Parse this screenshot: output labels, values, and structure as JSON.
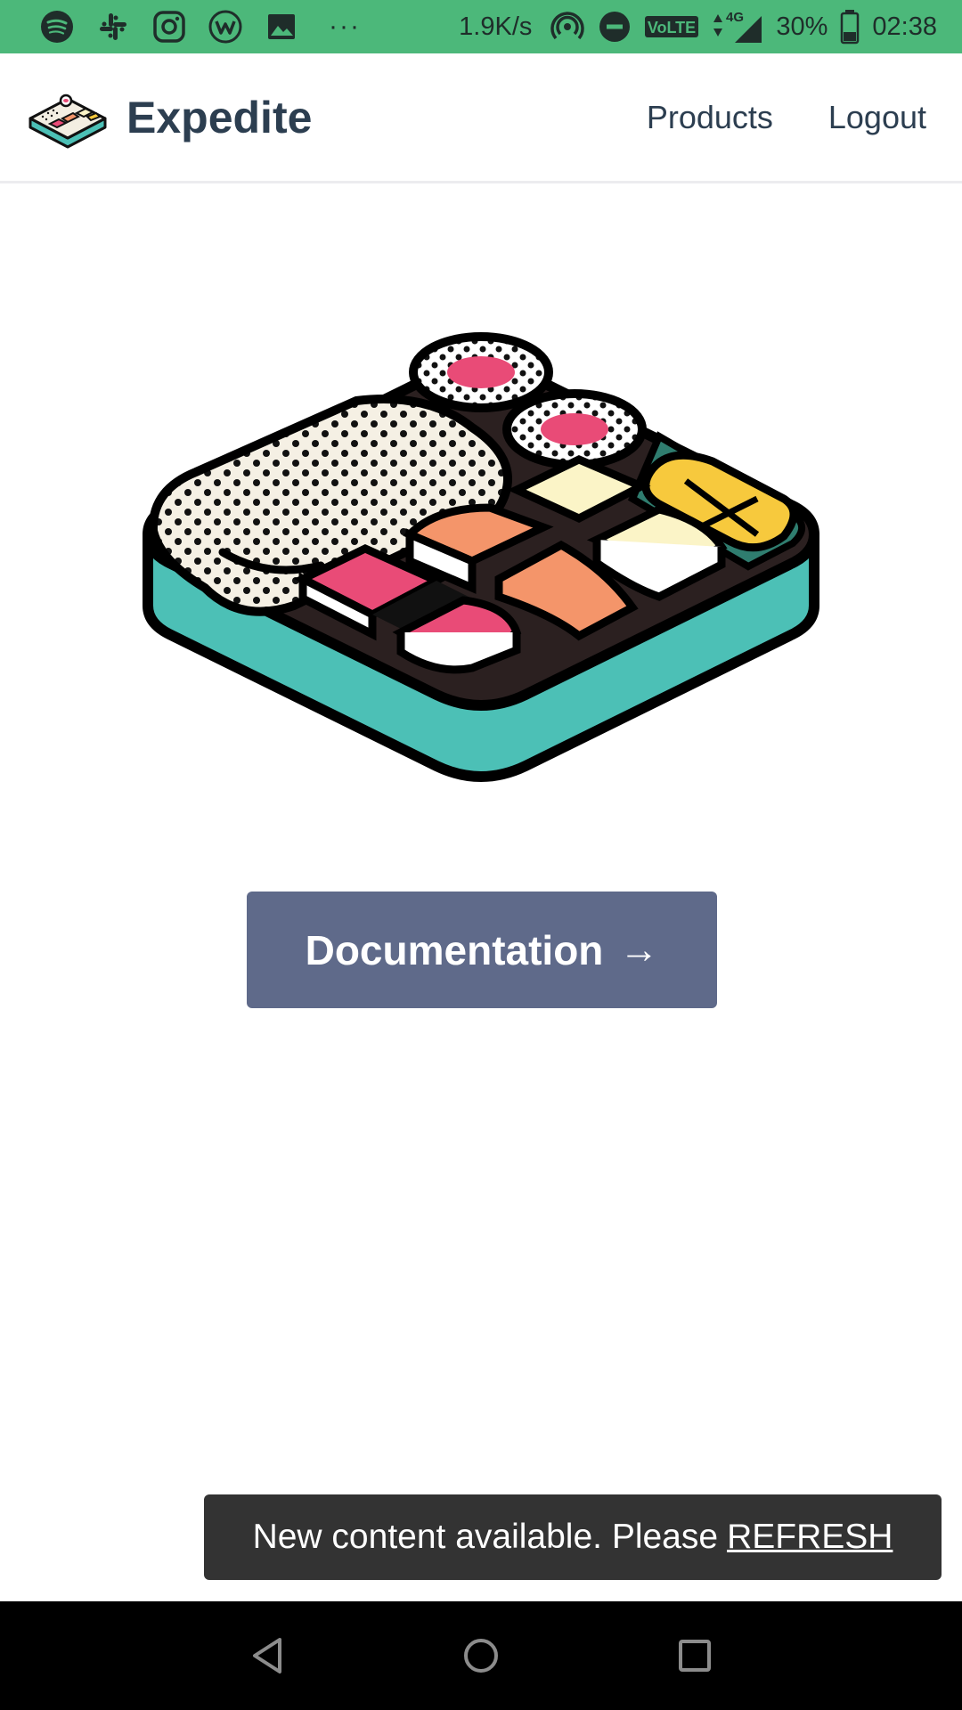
{
  "status_bar": {
    "left_icons": [
      "spotify-icon",
      "slack-icon",
      "instagram-icon",
      "wattpad-icon",
      "gallery-icon"
    ],
    "more": "···",
    "speed": "1.9K/s",
    "network_label": "VoLTE",
    "network_gen": "4G",
    "battery": "30%",
    "time": "02:38"
  },
  "navbar": {
    "brand": "Expedite",
    "links": [
      "Products",
      "Logout"
    ]
  },
  "hero": {
    "illustration": "bento-box-illustration",
    "colors": {
      "teal": "#4cc0b6",
      "pink": "#e94b77",
      "salmon": "#f4956a",
      "yellow": "#fbf4c7",
      "lemon": "#f7c93d"
    }
  },
  "doc_button": {
    "label": "Documentation",
    "arrow": "→",
    "color": "#5f6a8a"
  },
  "snackbar": {
    "message": "New content available. Please",
    "action": "REFRESH"
  },
  "android_nav": {
    "buttons": [
      "back-icon",
      "home-icon",
      "recents-icon"
    ]
  },
  "colors": {
    "status_bar": "#4cb87a",
    "brand_text": "#2c3e50"
  }
}
